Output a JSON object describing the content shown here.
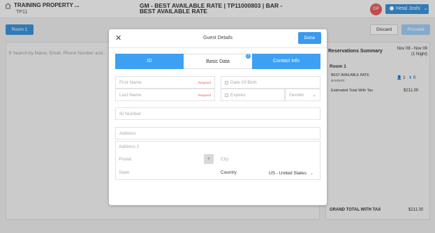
{
  "header": {
    "property_name": "TRAINING PROPERTY ...",
    "property_code": "TP11",
    "rate_title": "GM - BEST AVAILABLE RATE | TP11000803 | BAR - BEST AVAILABLE RATE",
    "avatar_initials": "GP",
    "user_name": "Hetal Joshi"
  },
  "toolbar": {
    "room_label": "Room 1",
    "discard_label": "Discard",
    "proceed_label": "Proceed"
  },
  "search": {
    "placeholder": "Search by Name, Email, Phone Number and..."
  },
  "summary": {
    "title": "Reservations Summary",
    "dates": "Nov 08 - Nov 09",
    "nights": "(1 Night)",
    "room": "Room 1",
    "rate_name": "BEST AVAILABLE RATE",
    "rate_code": "BAR/BSR",
    "adults": "1",
    "children": "0",
    "total_label": "Estimated Total With Tax",
    "total_value": "$211.00",
    "grand_label": "GRAND TOTAL WITH TAX",
    "grand_value": "$211.00"
  },
  "modal": {
    "title": "Guest Details",
    "done_label": "Done",
    "tabs": [
      {
        "label": "ID"
      },
      {
        "label": "Basic Data",
        "badge": "2"
      },
      {
        "label": "Contact Info"
      }
    ],
    "fields": {
      "first_name": "First Name",
      "last_name": "Last Name",
      "required": "Required",
      "dob": "Date Of Birth",
      "expires": "Expires",
      "gender": "Gender",
      "id_number": "ID Number",
      "address": "Address",
      "address2": "Address 2",
      "postal": "Postal",
      "city": "City",
      "state": "State",
      "country_label": "Country",
      "country_value": "US - United States"
    }
  },
  "colors": {
    "accent": "#3ea0f2",
    "required": "#e55555"
  }
}
